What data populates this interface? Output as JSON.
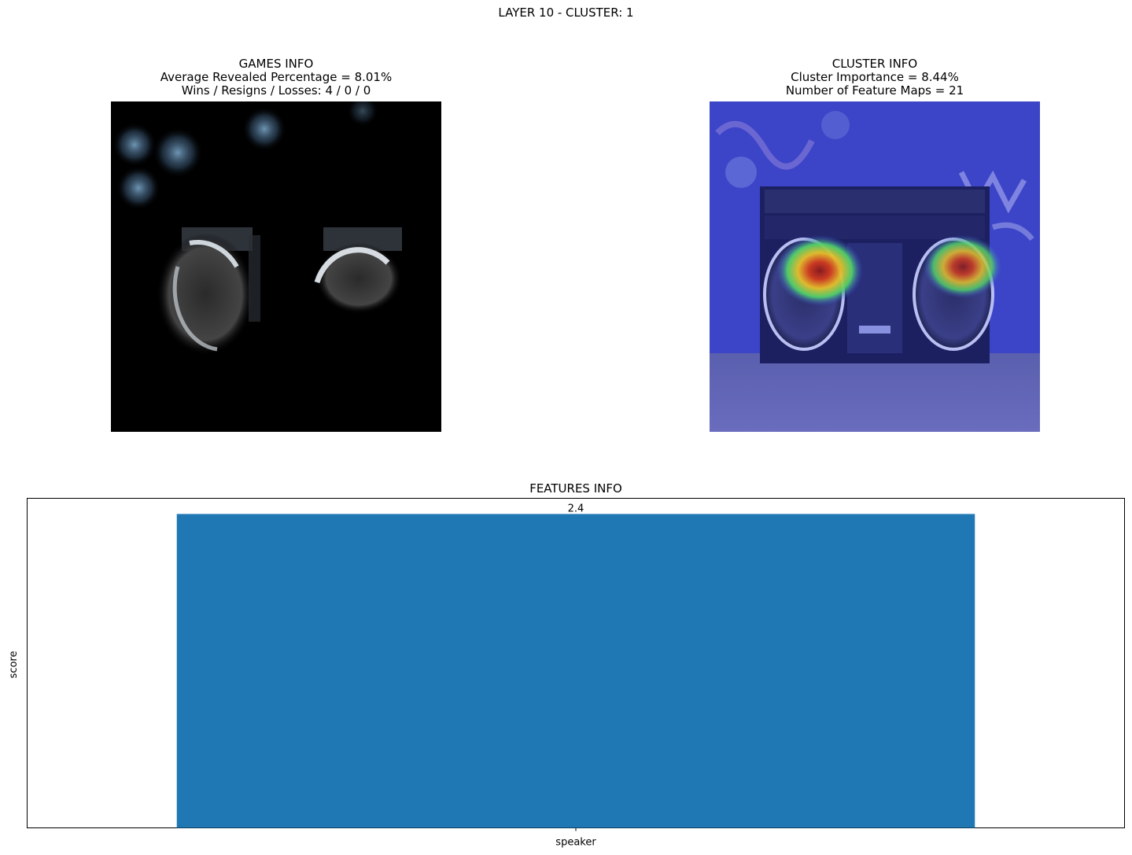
{
  "figure": {
    "suptitle": "LAYER 10 - CLUSTER: 1"
  },
  "games_panel": {
    "title": "GAMES INFO",
    "line1": "Average Revealed Percentage = 8.01%",
    "line2": "Wins / Resigns / Losses: 4 / 0 / 0",
    "image": "masked-boombox-speakers"
  },
  "cluster_panel": {
    "title": "CLUSTER INFO",
    "line1": "Cluster Importance = 8.44%",
    "line2": "Number of Feature Maps = 21",
    "image": "boombox-heatmap-overlay"
  },
  "features_panel": {
    "title": "FEATURES INFO"
  },
  "chart_data": {
    "type": "bar",
    "title": "FEATURES INFO",
    "categories": [
      "speaker"
    ],
    "values": [
      2.4
    ],
    "data_labels": [
      "2.4"
    ],
    "xlabel": "",
    "ylabel": "score",
    "y_ticks_shown": false,
    "grid": false,
    "bar_color": "#1f77b4"
  }
}
